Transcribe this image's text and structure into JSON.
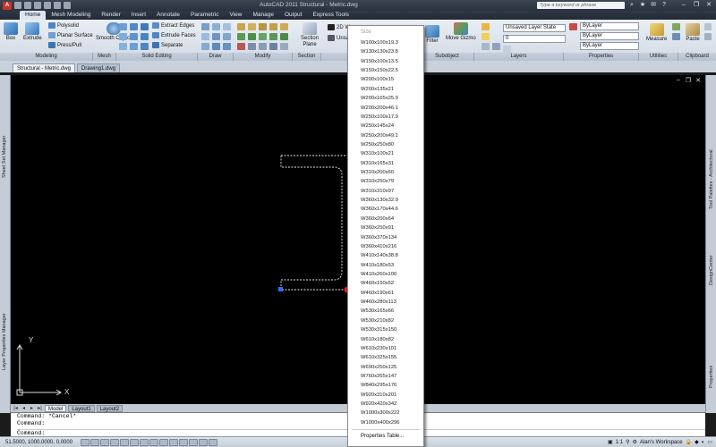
{
  "title_bar": {
    "app_title": "AutoCAD 2011   Structural - Metric.dwg",
    "search_placeholder": "Type a keyword or phrase"
  },
  "ribbon_tabs": [
    "Home",
    "Mesh Modeling",
    "Render",
    "Insert",
    "Annotate",
    "Parametric",
    "View",
    "Manage",
    "Output",
    "Express Tools"
  ],
  "ribbon": {
    "modeling": {
      "box": "Box",
      "extrude": "Extrude",
      "polysolid": "Polysolid",
      "planar_surface": "Planar Surface",
      "presspull": "Press/Pull"
    },
    "mesh": {
      "smooth_object": "Smooth Object"
    },
    "solid_editing": {
      "extract_edges": "Extract Edges",
      "extrude_faces": "Extrude Faces",
      "separate": "Separate"
    },
    "section": {
      "section_plane": "Section Plane",
      "partial": "2D W",
      "unsaved": "Unsa"
    },
    "subobject": {
      "filter": "Filter",
      "move_gizmo": "Move Gizmo"
    },
    "layers": {
      "layer_state": "Unsaved Layer State",
      "current_layer": "0"
    },
    "properties": {
      "color": "ByLayer",
      "linetype": "ByLayer",
      "lineweight": "ByLayer"
    },
    "utilities": {
      "measure": "Measure"
    },
    "clipboard": {
      "paste": "Paste"
    },
    "panel_labels": [
      "Modeling",
      "Mesh",
      "Solid Editing",
      "Draw",
      "Modify",
      "Section",
      "",
      "Subobject",
      "Layers",
      "Properties",
      "Utilities",
      "Clipboard"
    ]
  },
  "file_tabs": [
    "Structural - Metric.dwg",
    "Drawing1.dwg"
  ],
  "side_panels": {
    "left_top": "Sheet Set Manager",
    "left_bottom": "Layer Properties Manager",
    "right_top": "Tool Palettes - Architectural",
    "right_mid": "DesignCenter",
    "right_bottom": "Properties"
  },
  "ucs": {
    "x_label": "X",
    "y_label": "Y"
  },
  "layout_tabs": [
    "Model",
    "Layout1",
    "Layout2"
  ],
  "command_lines": [
    "Command: *Cancel*",
    "Command:"
  ],
  "command_prompt": "Command:",
  "status_bar": {
    "coordinates": "51.5000, 1000.0000, 0.0000",
    "annotation_scale": "1:1",
    "workspace": "Alan's Workspace"
  },
  "size_dropdown": {
    "header": "Size",
    "items": [
      "W100x100x19.3",
      "W130x130x23.8",
      "W150x100x13.5",
      "W150x150x22.5",
      "W200x100x15",
      "W200x135x21",
      "W200x165x25.9",
      "W200x200x46.1",
      "W250x100x17.9",
      "W250x145x24",
      "W250x200x49.1",
      "W250x250x80",
      "W310x100x21",
      "W310x165x31",
      "W310x200x60",
      "W310x250x79",
      "W310x310x97",
      "W360x130x32.9",
      "W360x170x44.6",
      "W360x200x64",
      "W360x250x91",
      "W360x370x134",
      "W360x410x216",
      "W410x140x38.8",
      "W410x180x53",
      "W410x260x100",
      "W460x150x52",
      "W460x190x61",
      "W460x280x113",
      "W530x165x66",
      "W530x210x82",
      "W530x315x150",
      "W610x180x82",
      "W610x230x101",
      "W610x325x155",
      "W690x250x125",
      "W760x265x147",
      "W840x295x176",
      "W920x310x201",
      "W920x420x342",
      "W1000x300x222",
      "W1000x400x296"
    ],
    "footer": "Properties Table..."
  }
}
